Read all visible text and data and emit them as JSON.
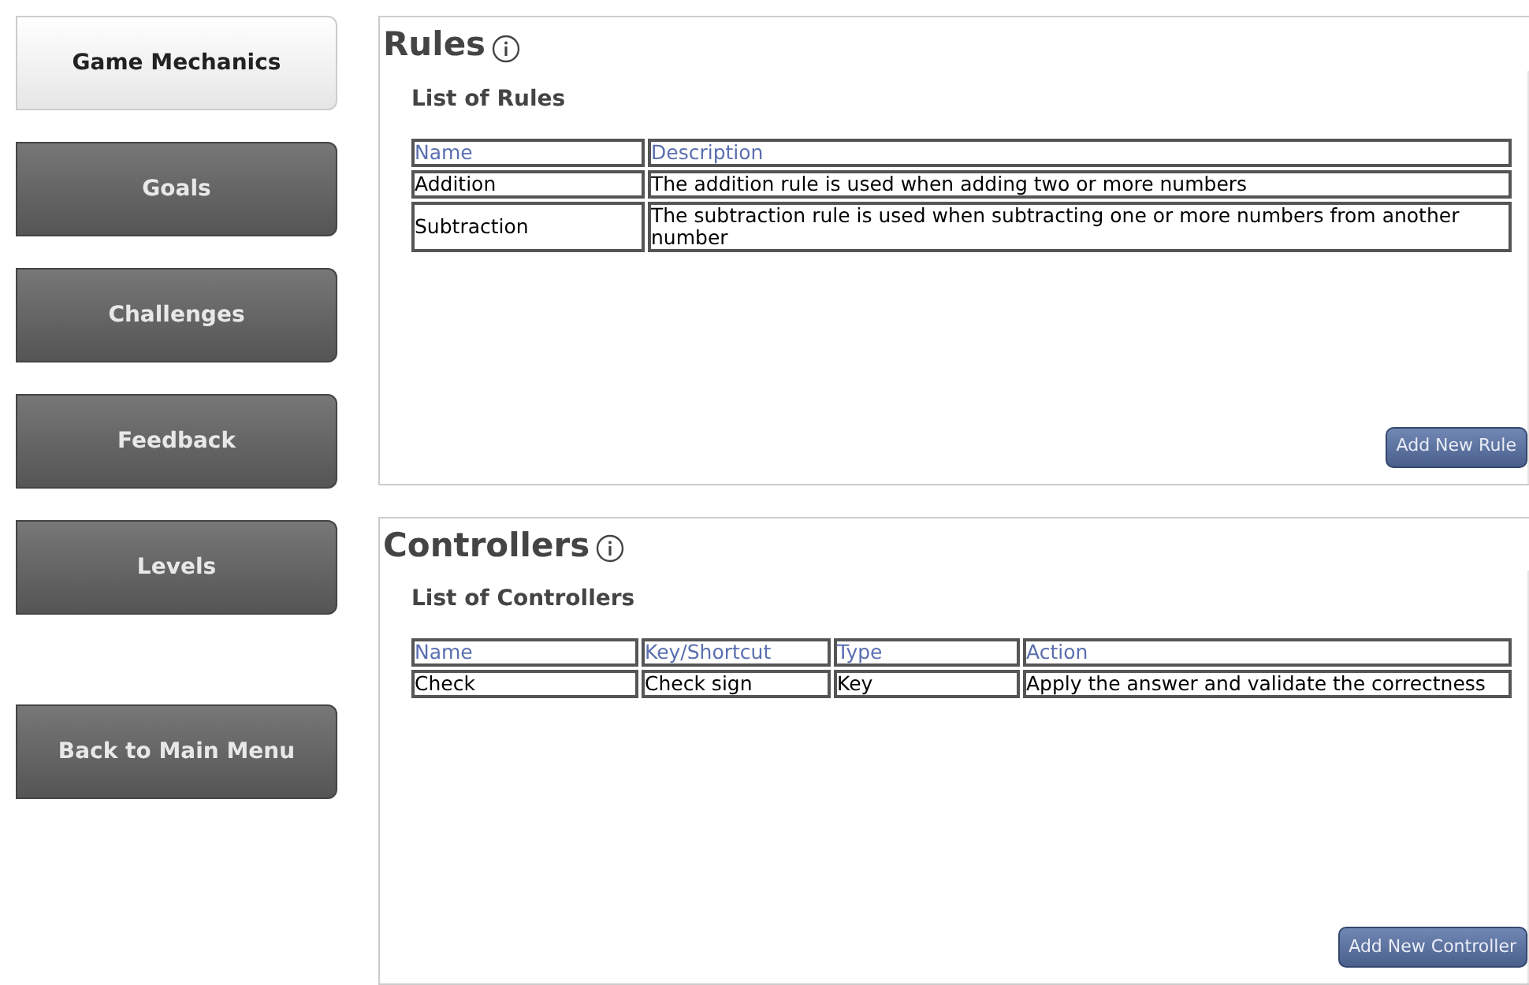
{
  "sidebar": {
    "items": [
      {
        "label": "Game Mechanics",
        "selected": true,
        "kind": "nav"
      },
      {
        "label": "Goals",
        "selected": false,
        "kind": "nav"
      },
      {
        "label": "Challenges",
        "selected": false,
        "kind": "nav"
      },
      {
        "label": "Feedback",
        "selected": false,
        "kind": "nav"
      },
      {
        "label": "Levels",
        "selected": false,
        "kind": "nav"
      },
      {
        "label": "Back to Main Menu",
        "selected": false,
        "kind": "back"
      }
    ]
  },
  "sections": [
    {
      "title": "Rules",
      "list_title": "List of Rules",
      "columns": [
        "Name",
        "Description"
      ],
      "rows": [
        [
          "Addition",
          "The addition rule is used when adding two or more numbers"
        ],
        [
          "Subtraction",
          "The subtraction rule is used when subtracting one or more numbers from another number"
        ]
      ],
      "button": "Add New Rule"
    },
    {
      "title": "Controllers",
      "list_title": "List of Controllers",
      "columns": [
        "Name",
        "Key/Shortcut",
        "Type",
        "Action"
      ],
      "rows": [
        [
          "Check",
          "Check sign",
          "Key",
          "Apply the answer and validate the correctness"
        ]
      ],
      "button": "Add New Controller"
    }
  ]
}
